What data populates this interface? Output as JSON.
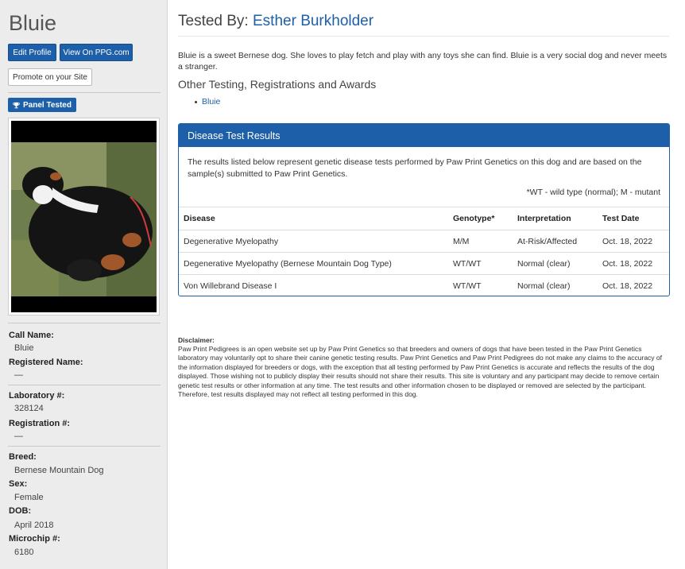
{
  "dog": {
    "name": "Bluie"
  },
  "buttons": {
    "edit_profile": "Edit Profile",
    "view_on_ppg": "View On PPG.com",
    "promote": "Promote on your Site"
  },
  "badge": {
    "label": "Panel Tested",
    "icon": "trophy-icon"
  },
  "details": [
    {
      "label": "Call Name:",
      "value": "Bluie"
    },
    {
      "label": "Registered Name:",
      "value": "—"
    },
    {
      "label": "Laboratory #:",
      "value": "328124"
    },
    {
      "label": "Registration #:",
      "value": "—"
    },
    {
      "label": "Breed:",
      "value": "Bernese Mountain Dog"
    },
    {
      "label": "Sex:",
      "value": "Female"
    },
    {
      "label": "DOB:",
      "value": "April 2018"
    },
    {
      "label": "Microchip #:",
      "value": "6180"
    }
  ],
  "main": {
    "tested_by_label": "Tested By:",
    "tested_by_name": "Esther Burkholder",
    "description": "Bluie is a sweet Bernese dog. She loves to play fetch and play with any toys she can find. Bluie is a very social dog and never meets a stranger.",
    "other_title": "Other Testing, Registrations and Awards",
    "other_items": [
      "Bluie"
    ]
  },
  "results": {
    "title": "Disease Test Results",
    "intro": "The results listed below represent genetic disease tests performed by Paw Print Genetics on this dog and are based on the sample(s) submitted to Paw Print Genetics.",
    "legend": "*WT - wild type (normal); M - mutant",
    "columns": [
      "Disease",
      "Genotype*",
      "Interpretation",
      "Test Date"
    ],
    "rows": [
      [
        "Degenerative Myelopathy",
        "M/M",
        "At-Risk/Affected",
        "Oct. 18, 2022"
      ],
      [
        "Degenerative Myelopathy (Bernese Mountain Dog Type)",
        "WT/WT",
        "Normal (clear)",
        "Oct. 18, 2022"
      ],
      [
        "Von Willebrand Disease I",
        "WT/WT",
        "Normal (clear)",
        "Oct. 18, 2022"
      ]
    ]
  },
  "disclaimer": {
    "title": "Disclaimer:",
    "text": "Paw Print Pedigrees is an open website set up by Paw Print Genetics so that breeders and owners of dogs that have been tested in the Paw Print Genetics laboratory may voluntarily opt to share their canine genetic testing results. Paw Print Genetics and Paw Print Pedigrees do not make any claims to the accuracy of the information displayed for breeders or dogs, with the exception that all testing performed by Paw Print Genetics is accurate and reflects the results of the dog displayed. Those wishing not to publicly display their results should not share their results. This site is voluntary and any participant may decide to remove certain genetic test results or other information at any time. The test results and other information chosen to be displayed or removed are selected by the participant. Therefore, test results displayed may not reflect all testing performed in this dog."
  },
  "colors": {
    "accent": "#1d5fa8",
    "sidebar_bg": "#ececec"
  }
}
